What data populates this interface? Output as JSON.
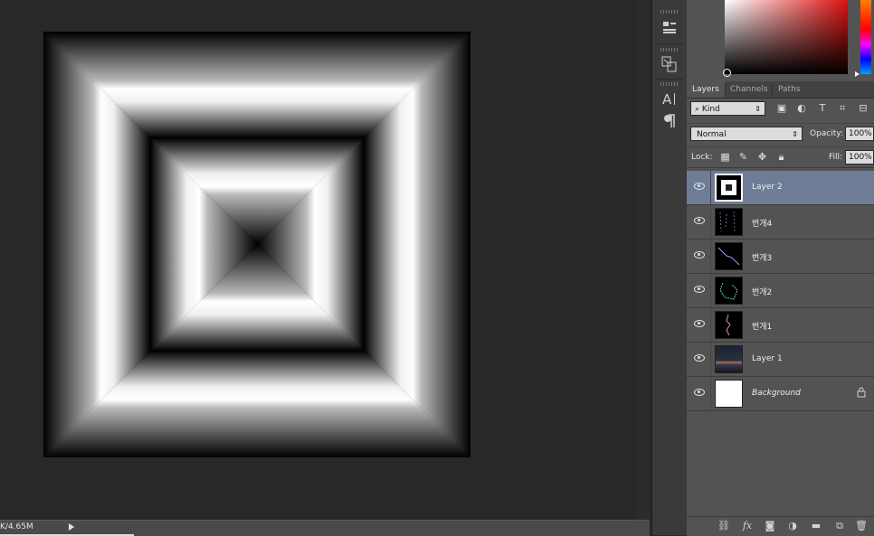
{
  "status": {
    "doc_size": "K/4.65M"
  },
  "layers_panel": {
    "tabs": [
      {
        "label": "Layers",
        "active": true
      },
      {
        "label": "Channels",
        "active": false
      },
      {
        "label": "Paths",
        "active": false
      }
    ],
    "filter": {
      "label": "Kind",
      "search_icon": "search-icon"
    },
    "blend_mode": "Normal",
    "opacity_label": "Opacity:",
    "opacity_value": "100%",
    "lock_label": "Lock:",
    "fill_label": "Fill:",
    "fill_value": "100%",
    "layers": [
      {
        "name": "Layer 2",
        "selected": true,
        "thumb": "square-gradient"
      },
      {
        "name": "번개4",
        "selected": false,
        "thumb": "dark"
      },
      {
        "name": "번개3",
        "selected": false,
        "thumb": "dark"
      },
      {
        "name": "번개2",
        "selected": false,
        "thumb": "dark"
      },
      {
        "name": "번개1",
        "selected": false,
        "thumb": "dark"
      },
      {
        "name": "Layer 1",
        "selected": false,
        "thumb": "city"
      },
      {
        "name": "Background",
        "selected": false,
        "thumb": "white",
        "locked": true
      }
    ]
  },
  "icons": {
    "iconbar": [
      "properties-icon",
      "clone-source-icon",
      "character-icon",
      "paragraph-icon"
    ],
    "filter": [
      "image-filter-icon",
      "adjustment-filter-icon",
      "type-filter-icon",
      "shape-filter-icon",
      "smart-object-filter-icon"
    ],
    "lock": [
      "lock-transparent-icon",
      "lock-pixels-icon",
      "lock-position-icon",
      "lock-all-icon"
    ],
    "bottom": [
      "link-layers-icon",
      "fx-icon",
      "add-mask-icon",
      "adjustment-layer-icon",
      "new-group-icon",
      "new-layer-icon",
      "delete-layer-icon"
    ]
  },
  "colors": {
    "selected_layer": "#6e7c95",
    "panel_bg": "#535353",
    "workspace_bg": "#282828"
  }
}
